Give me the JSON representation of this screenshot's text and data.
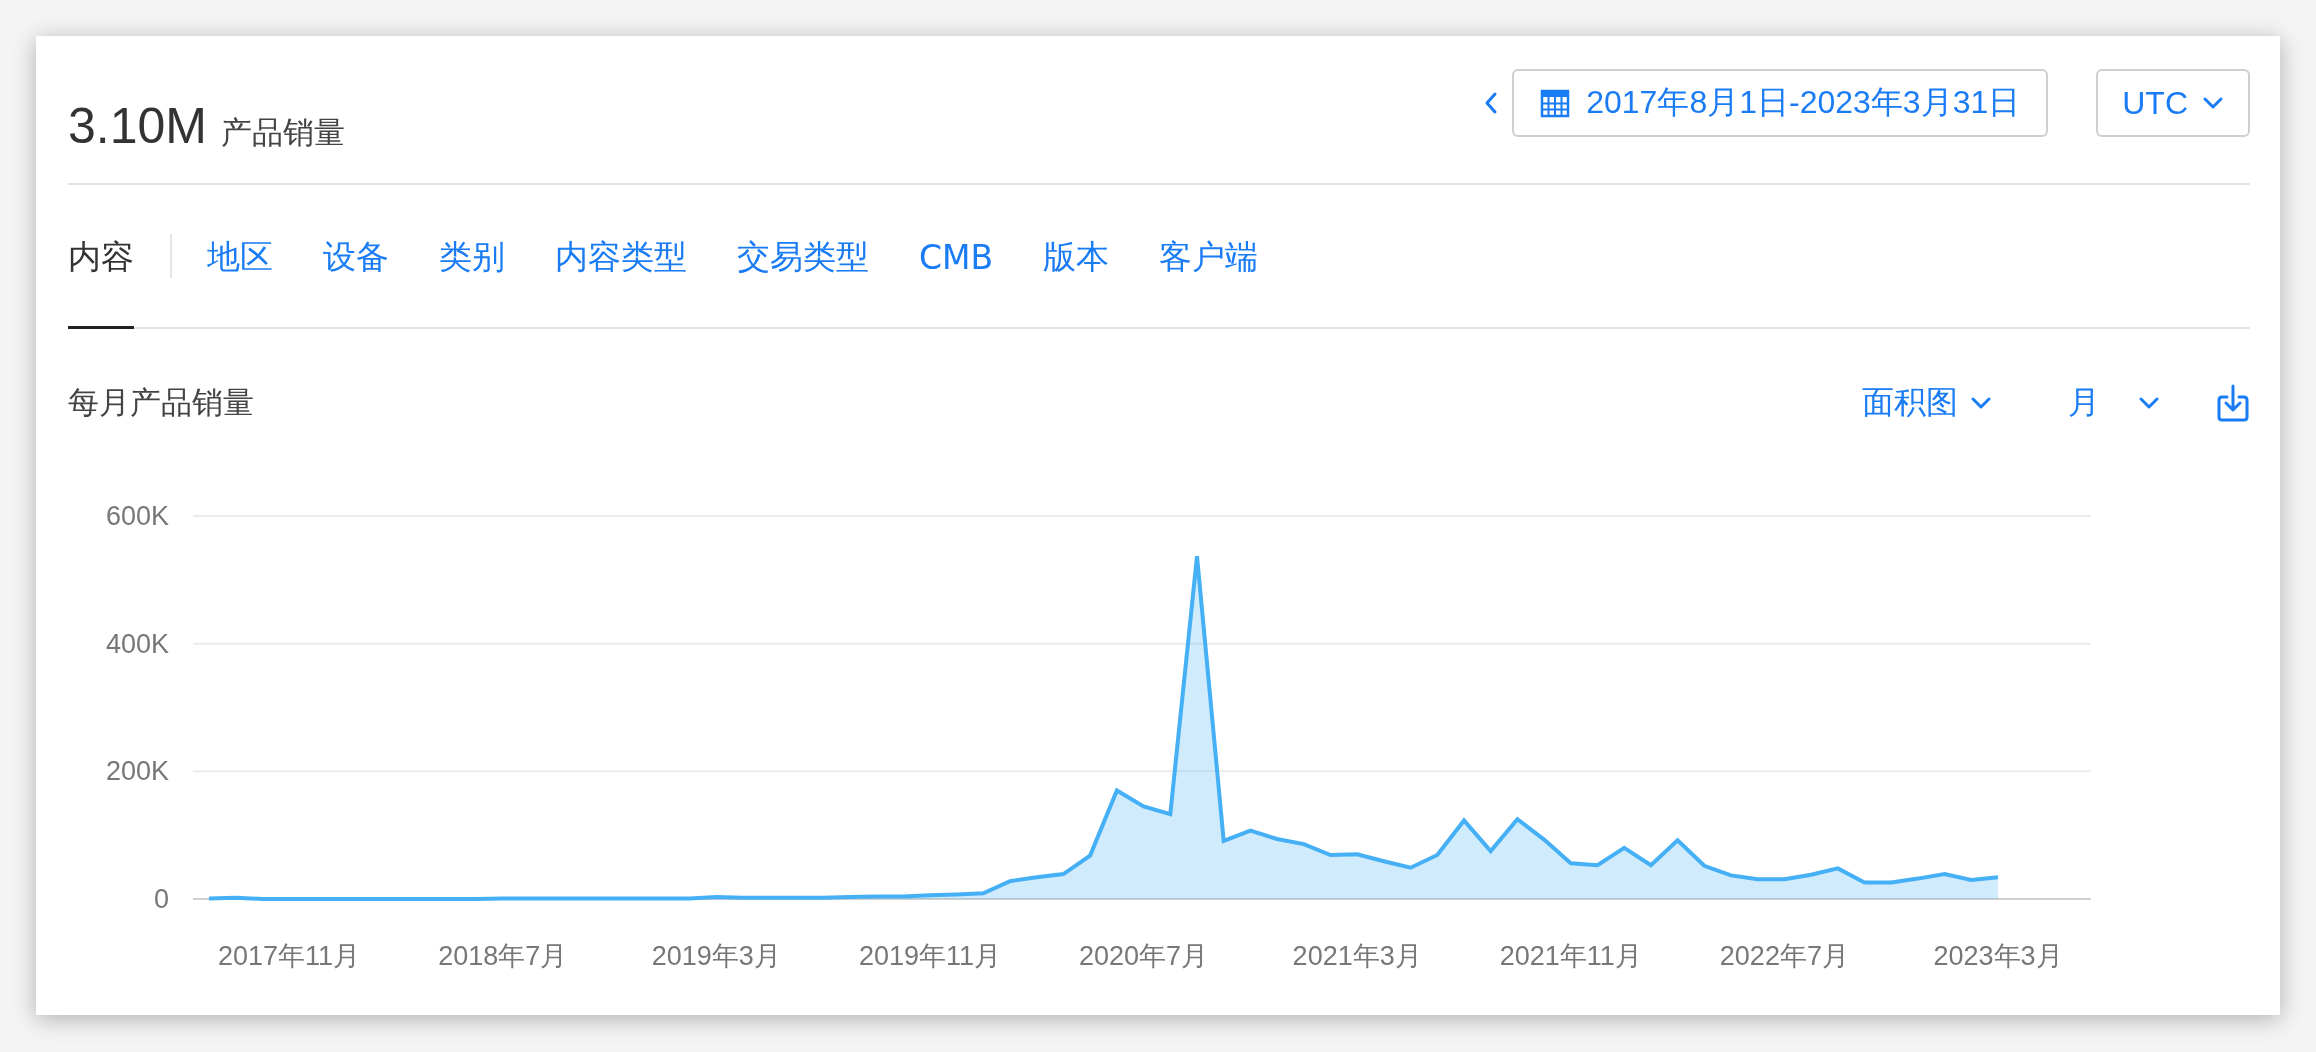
{
  "header": {
    "total": "3.10M",
    "total_label": "产品销量",
    "date_range": "2017年8月1日-2023年3月31日",
    "timezone": "UTC"
  },
  "tabs": [
    {
      "label": "内容",
      "selected": true
    },
    {
      "label": "地区",
      "selected": false
    },
    {
      "label": "设备",
      "selected": false
    },
    {
      "label": "类别",
      "selected": false
    },
    {
      "label": "内容类型",
      "selected": false
    },
    {
      "label": "交易类型",
      "selected": false
    },
    {
      "label": "CMB",
      "selected": false
    },
    {
      "label": "版本",
      "selected": false
    },
    {
      "label": "客户端",
      "selected": false
    }
  ],
  "chart_panel": {
    "title": "每月产品销量",
    "chart_type": "面积图",
    "interval": "月",
    "chart_data": {
      "type": "area",
      "categories": [
        null,
        null,
        null,
        "2017年11月",
        null,
        null,
        null,
        null,
        null,
        null,
        null,
        "2018年7月",
        null,
        null,
        null,
        null,
        null,
        null,
        null,
        "2019年3月",
        null,
        null,
        null,
        null,
        null,
        null,
        null,
        "2019年11月",
        null,
        null,
        null,
        null,
        null,
        null,
        null,
        "2020年7月",
        null,
        null,
        null,
        null,
        null,
        null,
        null,
        "2021年3月",
        null,
        null,
        null,
        null,
        null,
        null,
        null,
        "2021年11月",
        null,
        null,
        null,
        null,
        null,
        null,
        null,
        "2022年7月",
        null,
        null,
        null,
        null,
        null,
        null,
        null,
        "2023年3月"
      ],
      "series": [
        {
          "color": "#45b0f5",
          "values": [
            1000,
            2000,
            0,
            0,
            0,
            0,
            0,
            0,
            0,
            0,
            0,
            1000,
            1000,
            1000,
            1000,
            1000,
            1000,
            1000,
            1000,
            3000,
            2000,
            2000,
            2000,
            2000,
            3000,
            4000,
            4000,
            6000,
            7000,
            9000,
            28000,
            34000,
            39000,
            68000,
            170000,
            145000,
            133000,
            537000,
            91000,
            107000,
            94000,
            86000,
            69000,
            70000,
            59000,
            49000,
            69000,
            123000,
            75000,
            125000,
            93000,
            56000,
            53000,
            80000,
            53000,
            92000,
            52000,
            37000,
            31000,
            31000,
            38000,
            48000,
            26000,
            26000,
            32000,
            39000,
            30000,
            34000
          ]
        }
      ],
      "ylim": [
        0,
        600000
      ],
      "yticks": [
        {
          "value": 0,
          "label": "0"
        },
        {
          "value": 200000,
          "label": "200K"
        },
        {
          "value": 400000,
          "label": "400K"
        },
        {
          "value": 600000,
          "label": "600K"
        }
      ]
    }
  }
}
